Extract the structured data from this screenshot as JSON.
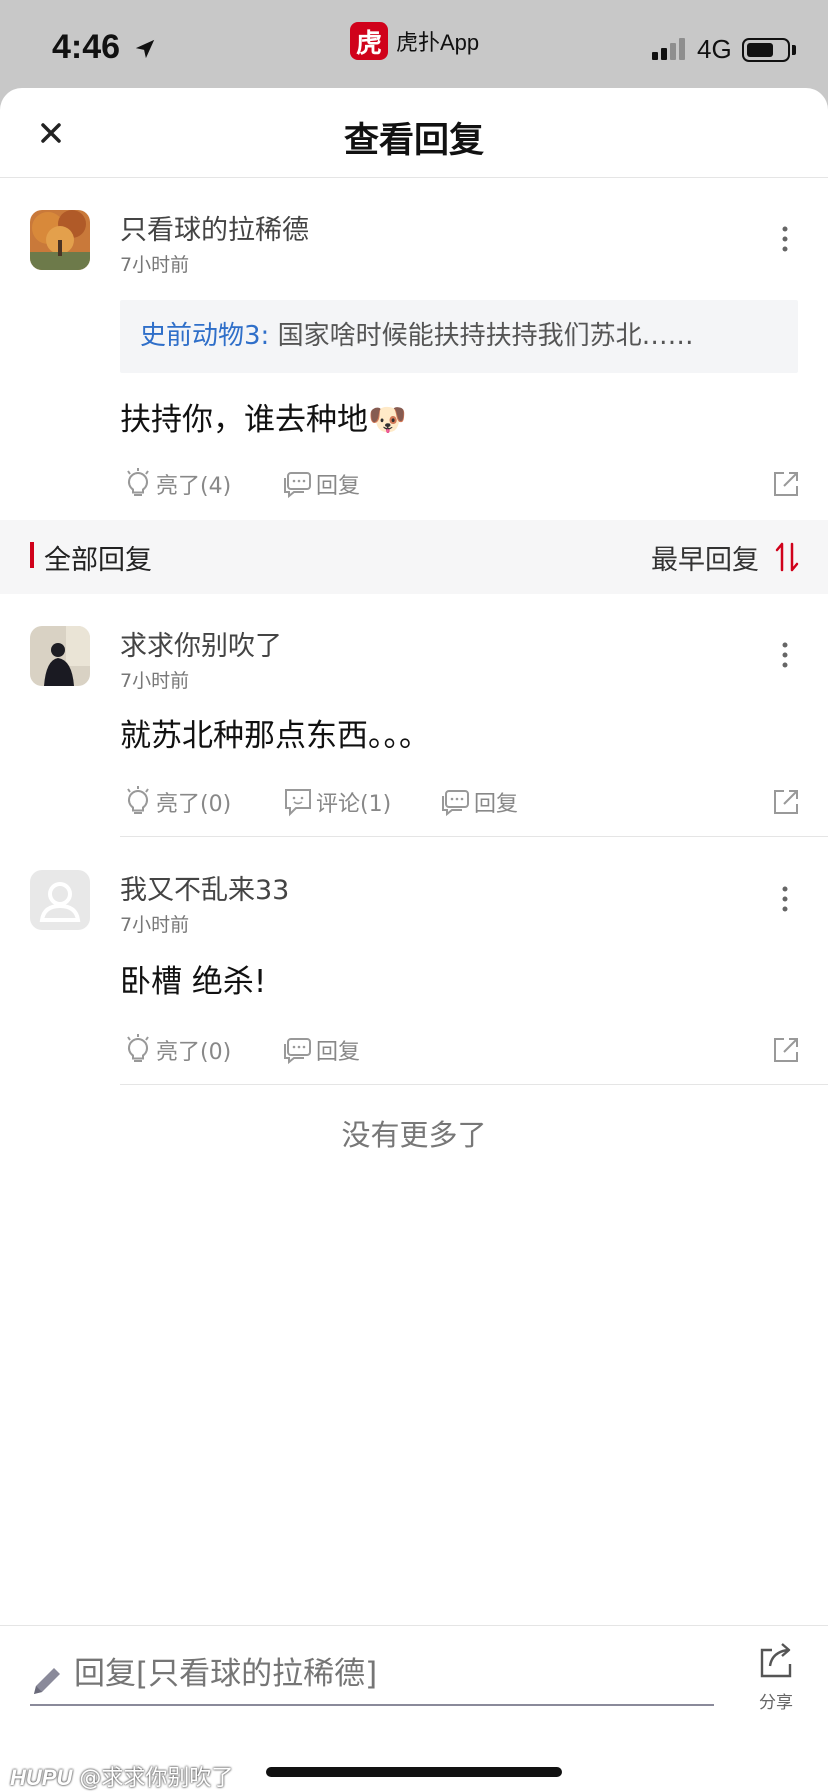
{
  "status_bar": {
    "time": "4:46",
    "app_name": "虎扑App",
    "app_logo_char": "虎",
    "network": "4G"
  },
  "header": {
    "title": "查看回复"
  },
  "main_post": {
    "username": "只看球的拉稀德",
    "time": "7小时前",
    "quote_author": "史前动物3:",
    "quote_text": " 国家啥时候能扶持扶持我们苏北……",
    "body": "扶持你，谁去种地🐶",
    "like_label": "亮了(4)",
    "reply_label": "回复"
  },
  "section": {
    "title": "全部回复",
    "sort_label": "最早回复"
  },
  "replies": [
    {
      "username": "求求你别吹了",
      "time": "7小时前",
      "body": "就苏北种那点东西。。。",
      "like_label": "亮了(0)",
      "comment_label": "评论(1)",
      "reply_label": "回复"
    },
    {
      "username": "我又不乱来33",
      "time": "7小时前",
      "body": "卧槽 绝杀!",
      "like_label": "亮了(0)",
      "reply_label": "回复"
    }
  ],
  "no_more": "没有更多了",
  "composer": {
    "placeholder": "回复[只看球的拉稀德]",
    "share_label": "分享"
  },
  "watermark": {
    "brand": "HUPU",
    "user": "@求求你别吹了"
  },
  "colors": {
    "accent": "#d0021b",
    "link": "#2f6fc9"
  }
}
